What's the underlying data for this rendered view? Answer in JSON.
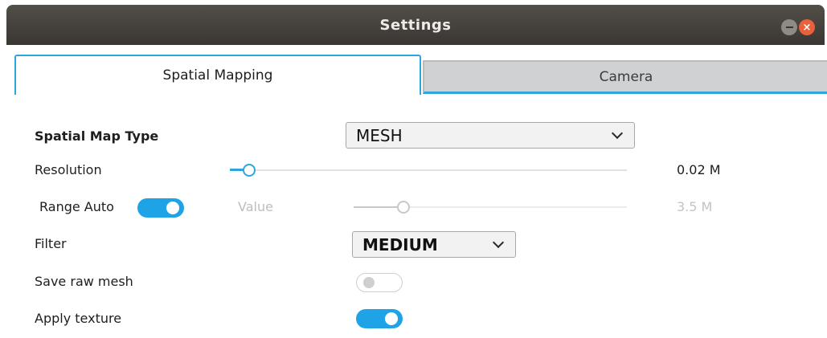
{
  "window": {
    "title": "Settings",
    "close_glyph": "×"
  },
  "tabs": [
    {
      "label": "Spatial Mapping",
      "active": true
    },
    {
      "label": "Camera",
      "active": false
    }
  ],
  "form": {
    "map_type": {
      "label": "Spatial Map Type",
      "selected": "MESH"
    },
    "resolution": {
      "label": "Resolution",
      "value_text": "0.02 M",
      "level": 0.06
    },
    "range": {
      "label": "Range Auto",
      "toggle_on": true,
      "value_label": "Value",
      "value_text": "3.5 M",
      "level": 0.18,
      "disabled": true
    },
    "filter": {
      "label": "Filter",
      "selected": "MEDIUM"
    },
    "save_raw_mesh": {
      "label": "Save raw mesh",
      "toggle_on": false
    },
    "apply_texture": {
      "label": "Apply texture",
      "toggle_on": true
    }
  },
  "colors": {
    "accent": "#2ea6dc",
    "toggle_on": "#1da3e6",
    "titlebar": "#3f3c37",
    "close_button": "#e9603a"
  },
  "icons": [
    "minimize-icon",
    "close-icon",
    "chevron-down-icon"
  ]
}
